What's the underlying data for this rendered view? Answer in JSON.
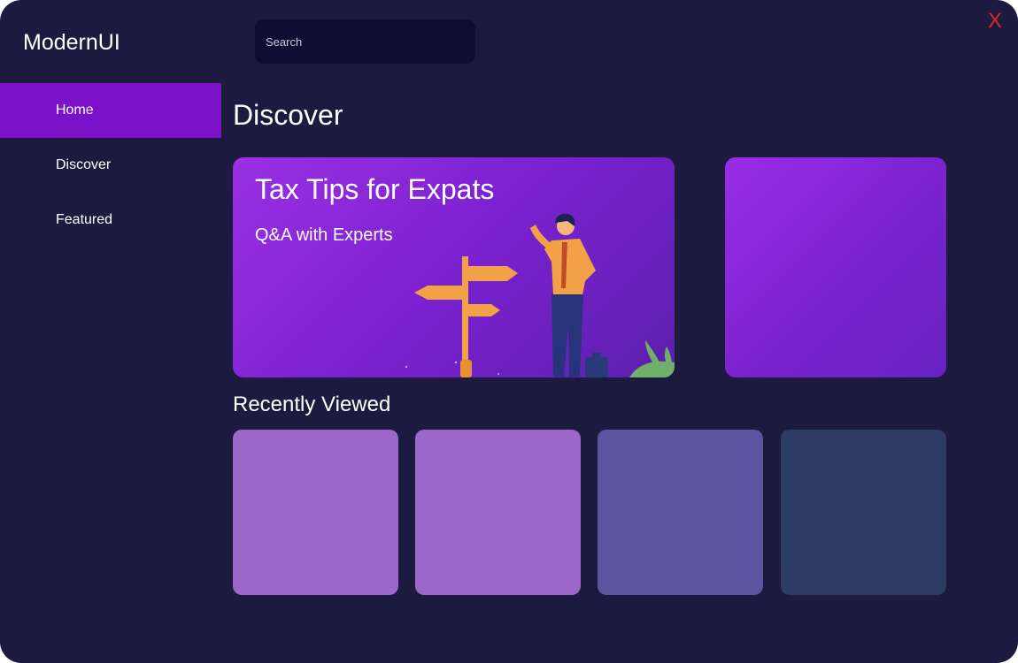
{
  "app": {
    "title": "ModernUI",
    "close_label": "X"
  },
  "search": {
    "placeholder": "Search",
    "value": ""
  },
  "nav": {
    "items": [
      {
        "label": "Home",
        "active": true
      },
      {
        "label": "Discover",
        "active": false
      },
      {
        "label": "Featured",
        "active": false
      }
    ]
  },
  "main": {
    "title": "Discover",
    "featured": {
      "title": "Tax Tips for Expats",
      "subtitle": "Q&A with Experts"
    },
    "recent": {
      "title": "Recently Viewed",
      "tiles": [
        {
          "color": "#9b67c9"
        },
        {
          "color": "#9b67c9"
        },
        {
          "color": "#5d55a0"
        },
        {
          "color": "#2c3c65"
        }
      ]
    }
  },
  "colors": {
    "background": "#1c1b3f",
    "nav_active": "#7b12c9",
    "search_bg": "#0e0c30",
    "close": "#d42a2a",
    "card_purple": "#8a28dc"
  }
}
